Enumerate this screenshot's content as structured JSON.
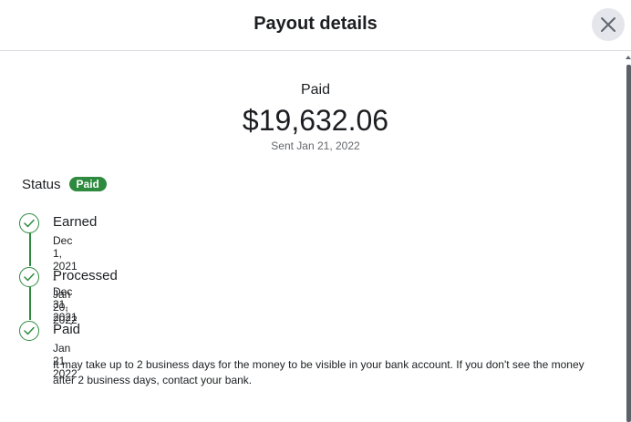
{
  "header": {
    "title": "Payout details",
    "close_icon": "close-icon"
  },
  "summary": {
    "status": "Paid",
    "amount": "$19,632.06",
    "sent": "Sent Jan 21, 2022"
  },
  "status": {
    "label": "Status",
    "badge": "Paid",
    "badge_color": "#2d8a3e"
  },
  "timeline": {
    "steps": [
      {
        "title": "Earned",
        "date": "Dec 1, 2021 - Dec 31, 2021",
        "icon": "check-circle-icon"
      },
      {
        "title": "Processed",
        "date": "Jan 20, 2022",
        "icon": "check-circle-icon"
      },
      {
        "title": "Paid",
        "date": "Jan 21, 2022",
        "icon": "check-circle-icon",
        "note": "It may take up to 2 business days for the money to be visible in your bank account. If you don't see the money after 2 business days, contact your bank."
      }
    ]
  }
}
